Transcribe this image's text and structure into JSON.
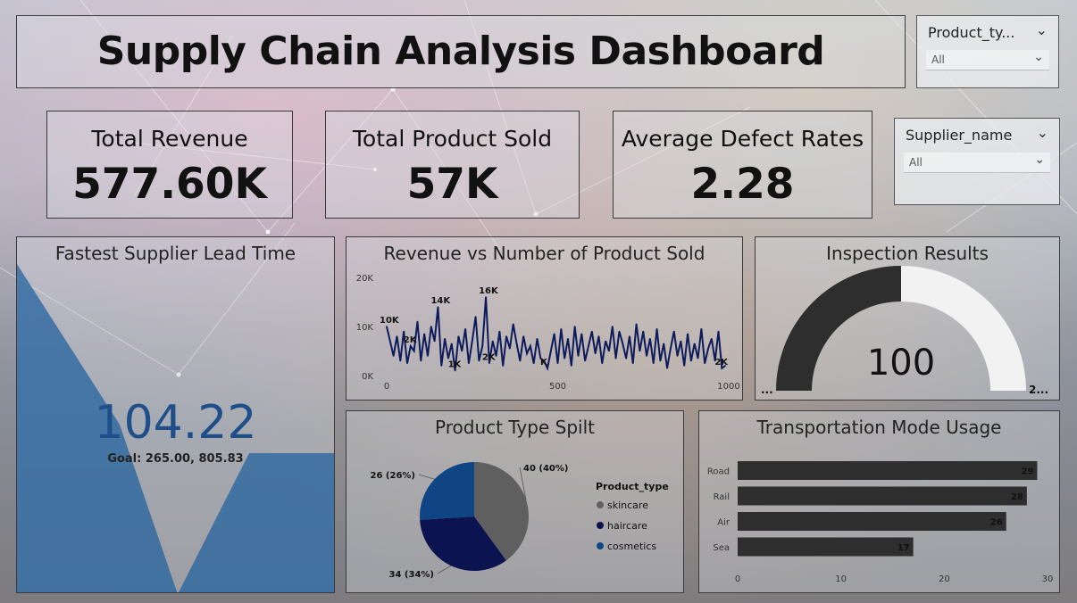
{
  "title": "Supply Chain Analysis Dashboard",
  "slicers": [
    {
      "label": "Product_ty...",
      "value": "All"
    },
    {
      "label": "Supplier_name",
      "value": "All"
    }
  ],
  "kpis": [
    {
      "label": "Total Revenue",
      "value": "577.60K"
    },
    {
      "label": "Total Product Sold",
      "value": "57K"
    },
    {
      "label": "Average Defect Rates",
      "value": "2.28"
    }
  ],
  "lead_time": {
    "title": "Fastest Supplier Lead Time",
    "value": "104.22",
    "goal": "Goal: 265.00, 805.83",
    "color": "#1f5f9e"
  },
  "chart_data": [
    {
      "type": "line",
      "title": "Revenue vs Number of Product Sold",
      "x_ticks": [
        "0",
        "500",
        "1000"
      ],
      "y_ticks": [
        "0K",
        "10K",
        "20K"
      ],
      "xlim": [
        0,
        1000
      ],
      "ylim": [
        0,
        20000
      ],
      "x": [
        0,
        10,
        20,
        30,
        40,
        50,
        60,
        70,
        80,
        90,
        100,
        110,
        120,
        130,
        140,
        150,
        160,
        170,
        180,
        190,
        200,
        210,
        220,
        230,
        240,
        250,
        260,
        270,
        280,
        290,
        300,
        310,
        320,
        330,
        340,
        350,
        360,
        370,
        380,
        390,
        400,
        410,
        420,
        430,
        440,
        450,
        460,
        470,
        480,
        490,
        500,
        510,
        520,
        530,
        540,
        550,
        560,
        570,
        580,
        590,
        600,
        610,
        620,
        630,
        640,
        650,
        660,
        670,
        680,
        690,
        700,
        710,
        720,
        730,
        740,
        750,
        760,
        770,
        780,
        790,
        800,
        810,
        820,
        830,
        840,
        850,
        860,
        870,
        880,
        890,
        900,
        910,
        920,
        930,
        940,
        950,
        960,
        970,
        980,
        990
      ],
      "values": [
        10000,
        7000,
        4000,
        8000,
        3000,
        9000,
        2500,
        6000,
        5000,
        11000,
        3000,
        8500,
        4000,
        10000,
        7000,
        14000,
        2000,
        7500,
        3500,
        6500,
        1000,
        8000,
        5000,
        9500,
        2500,
        7000,
        12000,
        3000,
        6000,
        16000,
        2500,
        7000,
        4000,
        9000,
        2000,
        8000,
        5500,
        10500,
        6500,
        3000,
        8000,
        4500,
        6000,
        2500,
        7500,
        3500,
        3000,
        1500,
        5000,
        8500,
        2500,
        9500,
        3500,
        7500,
        2000,
        10000,
        4000,
        8500,
        3000,
        6000,
        9000,
        4500,
        8000,
        2500,
        7000,
        5000,
        10000,
        3500,
        9000,
        6500,
        3500,
        8000,
        2500,
        10500,
        5000,
        9000,
        4000,
        7500,
        2500,
        9500,
        3000,
        6500,
        1500,
        5500,
        9000,
        4000,
        7000,
        2000,
        8500,
        3000,
        6500,
        3500,
        9500,
        2500,
        5500,
        7500,
        3000,
        9000,
        1500,
        2000
      ],
      "data_labels": [
        "10K",
        "14K",
        "16K",
        "2K",
        "1K",
        "2K",
        "K",
        "2K"
      ],
      "color": "#0d1b5c"
    },
    {
      "type": "gauge",
      "title": "Inspection Results",
      "value": "100",
      "min_label": "...",
      "max_label": "2...",
      "fill_fraction": 0.5,
      "colors": [
        "#2e2e2e",
        "#f2f2f2"
      ]
    },
    {
      "type": "pie",
      "title": "Product Type Spilt",
      "legend_title": "Product_type",
      "slices": [
        {
          "name": "skincare",
          "value": 40,
          "label": "40 (40%)",
          "color": "#5f5f5f"
        },
        {
          "name": "haircare",
          "value": 34,
          "label": "34 (34%)",
          "color": "#0b1450"
        },
        {
          "name": "cosmetics",
          "value": 26,
          "label": "26 (26%)",
          "color": "#0f4585"
        }
      ]
    },
    {
      "type": "bar",
      "orientation": "horizontal",
      "title": "Transportation Mode Usage",
      "categories": [
        "Road",
        "Rail",
        "Air",
        "Sea"
      ],
      "values": [
        29,
        28,
        26,
        17
      ],
      "x_ticks": [
        "0",
        "10",
        "20",
        "30"
      ],
      "xlim": [
        0,
        30
      ],
      "color": "#2e2e2e"
    }
  ]
}
